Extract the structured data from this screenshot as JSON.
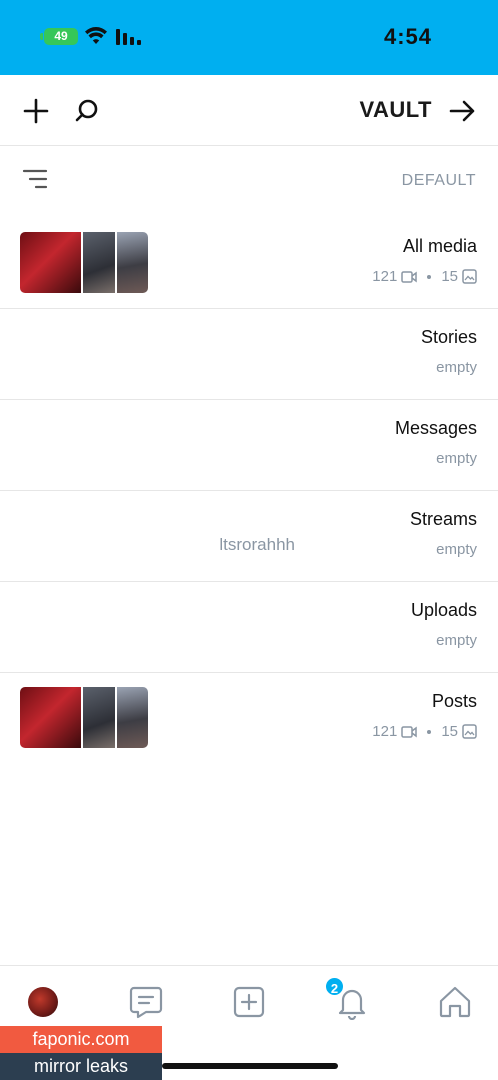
{
  "status": {
    "time": "4:54",
    "battery": "49"
  },
  "header": {
    "title": "VAULT"
  },
  "sort": {
    "label": "DEFAULT"
  },
  "lists": [
    {
      "title": "All media",
      "photos": "15",
      "videos": "121",
      "has_thumbs": true
    },
    {
      "title": "Stories",
      "subtitle": "empty"
    },
    {
      "title": "Messages",
      "subtitle": "empty"
    },
    {
      "title": "Streams",
      "subtitle": "empty",
      "extra": "ltsrorahhh"
    },
    {
      "title": "Uploads",
      "subtitle": "empty"
    },
    {
      "title": "Posts",
      "photos": "15",
      "videos": "121",
      "has_thumbs": true
    }
  ],
  "tabbar": {
    "notification_count": "2"
  },
  "watermark": {
    "line1": "faponic.com",
    "line2": "mirror leaks"
  },
  "colors": {
    "accent": "#00aff0",
    "muted": "#8a96a3"
  }
}
